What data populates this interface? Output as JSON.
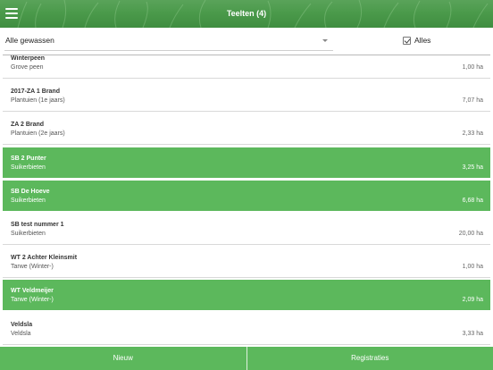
{
  "header": {
    "title": "Teelten (4)",
    "menu_icon": "hamburger-menu-icon"
  },
  "filter": {
    "crop_select_value": "Alle gewassen",
    "all_checkbox_label": "Alles",
    "all_checked": true
  },
  "rows": [
    {
      "name": "Winterpeen",
      "crop": "Grove peen",
      "area": "1,00 ha",
      "selected": false
    },
    {
      "name": "2017-ZA 1 Brand",
      "crop": "Plantuien (1e jaars)",
      "area": "7,07 ha",
      "selected": false
    },
    {
      "name": "ZA 2 Brand",
      "crop": "Plantuien (2e jaars)",
      "area": "2,33 ha",
      "selected": false
    },
    {
      "name": "SB 2 Punter",
      "crop": "Suikerbieten",
      "area": "3,25 ha",
      "selected": true
    },
    {
      "name": "SB De Hoeve",
      "crop": "Suikerbieten",
      "area": "6,68 ha",
      "selected": true
    },
    {
      "name": "SB test nummer 1",
      "crop": "Suikerbieten",
      "area": "20,00 ha",
      "selected": false
    },
    {
      "name": "WT 2 Achter Kleinsmit",
      "crop": "Tarwe (Winter-)",
      "area": "1,00 ha",
      "selected": false
    },
    {
      "name": "WT Veldmeijer",
      "crop": "Tarwe (Winter-)",
      "area": "2,09 ha",
      "selected": true
    },
    {
      "name": "Veldsla",
      "crop": "Veldsla",
      "area": "3,33 ha",
      "selected": false
    }
  ],
  "footer": {
    "new_label": "Nieuw",
    "registrations_label": "Registraties"
  },
  "colors": {
    "header_green": "#4b9a4b",
    "selected_green": "#5cb85c",
    "footer_green": "#5cb85c"
  }
}
